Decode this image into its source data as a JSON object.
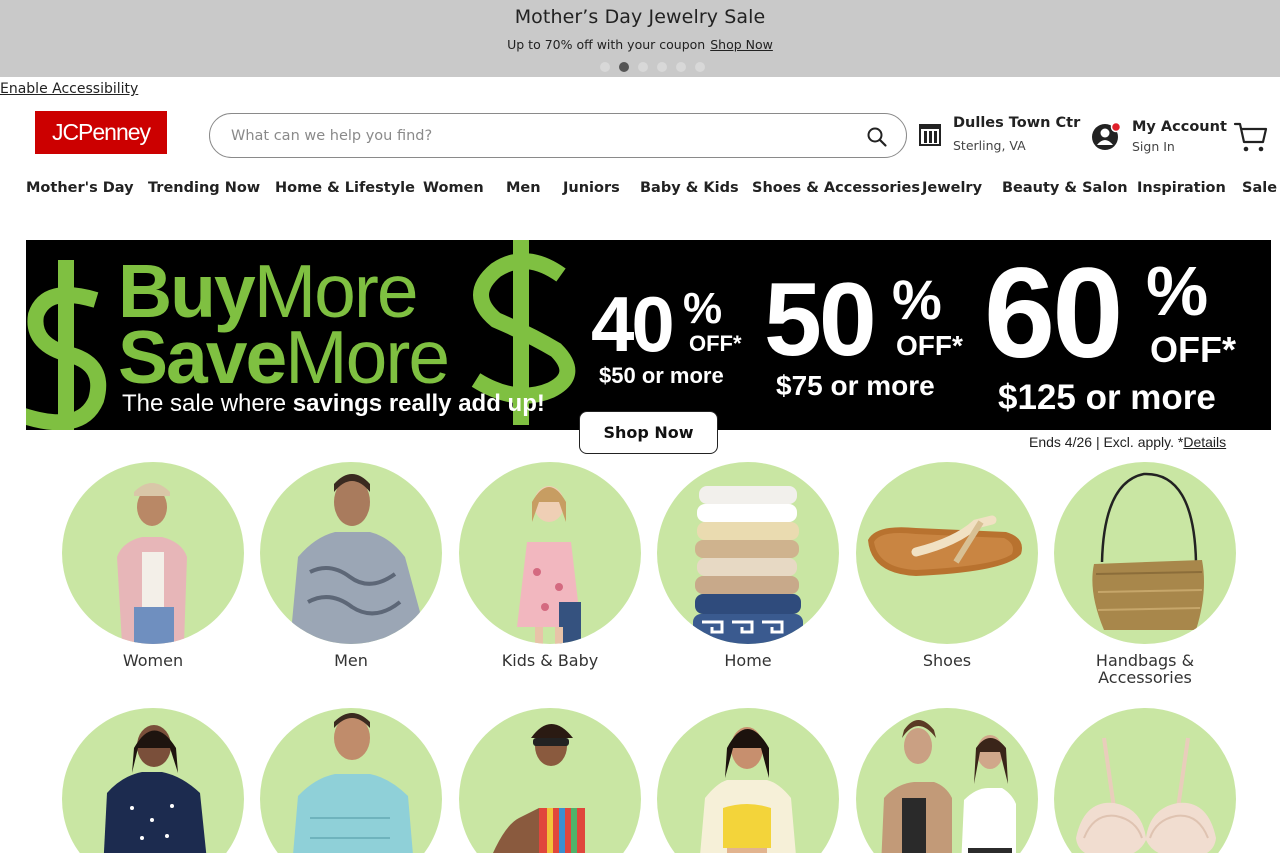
{
  "promo": {
    "title": "Mother’s Day Jewelry Sale",
    "subtitle": "Up to 70% off with your coupon",
    "link": "Shop Now",
    "slides": 6,
    "active_slide": 2
  },
  "accessibility_link": "Enable Accessibility",
  "header": {
    "logo": "JCPenney",
    "search_placeholder": "What can we help you find?",
    "store_name": "Dulles Town Ctr",
    "store_location": "Sterling, VA",
    "account_label": "My Account",
    "account_sign_in": "Sign In"
  },
  "nav": [
    "Mother's Day",
    "Trending Now",
    "Home & Lifestyle",
    "Women",
    "Men",
    "Juniors",
    "Baby & Kids",
    "Shoes & Accessories",
    "Jewelry",
    "Beauty & Salon",
    "Inspiration",
    "Sale"
  ],
  "banner": {
    "line1_bold": "Buy",
    "line1_light": "More",
    "line2_bold": "Save",
    "line2_light": "More",
    "tagline_light": "The sale where ",
    "tagline_bold": "savings really add up!",
    "tiers": [
      {
        "pct": "40",
        "off": "OFF*",
        "condition": "$50 or more"
      },
      {
        "pct": "50",
        "off": "OFF*",
        "condition": "$75 or more"
      },
      {
        "pct": "60",
        "off": "OFF*",
        "condition": "$125 or more"
      }
    ],
    "shop_now": "Shop Now",
    "ends_text": "Ends 4/26 | Excl. apply. *",
    "details_link": "Details",
    "colors": {
      "green": "#7fc041",
      "background": "#000000"
    }
  },
  "categories": [
    {
      "label": "Women",
      "icon": "woman-pink-shirt-image"
    },
    {
      "label": "Men",
      "icon": "man-print-shirt-image"
    },
    {
      "label": "Kids & Baby",
      "icon": "girl-floral-dress-image"
    },
    {
      "label": "Home",
      "icon": "towel-stack-image"
    },
    {
      "label": "Shoes",
      "icon": "sandal-image"
    },
    {
      "label": "Handbags & Accessories",
      "icon": "handbag-image"
    }
  ],
  "categories_row2": [
    {
      "icon": "woman-navy-top-image"
    },
    {
      "icon": "man-blue-shirt-image"
    },
    {
      "icon": "woman-striped-swimsuit-image"
    },
    {
      "icon": "woman-yellow-top-image"
    },
    {
      "icon": "couple-casual-image"
    },
    {
      "icon": "bra-image"
    }
  ],
  "colors": {
    "circle_bg": "#c9e6a3",
    "brand_red": "#cc0000",
    "promo_bg": "#c9c9c9"
  }
}
